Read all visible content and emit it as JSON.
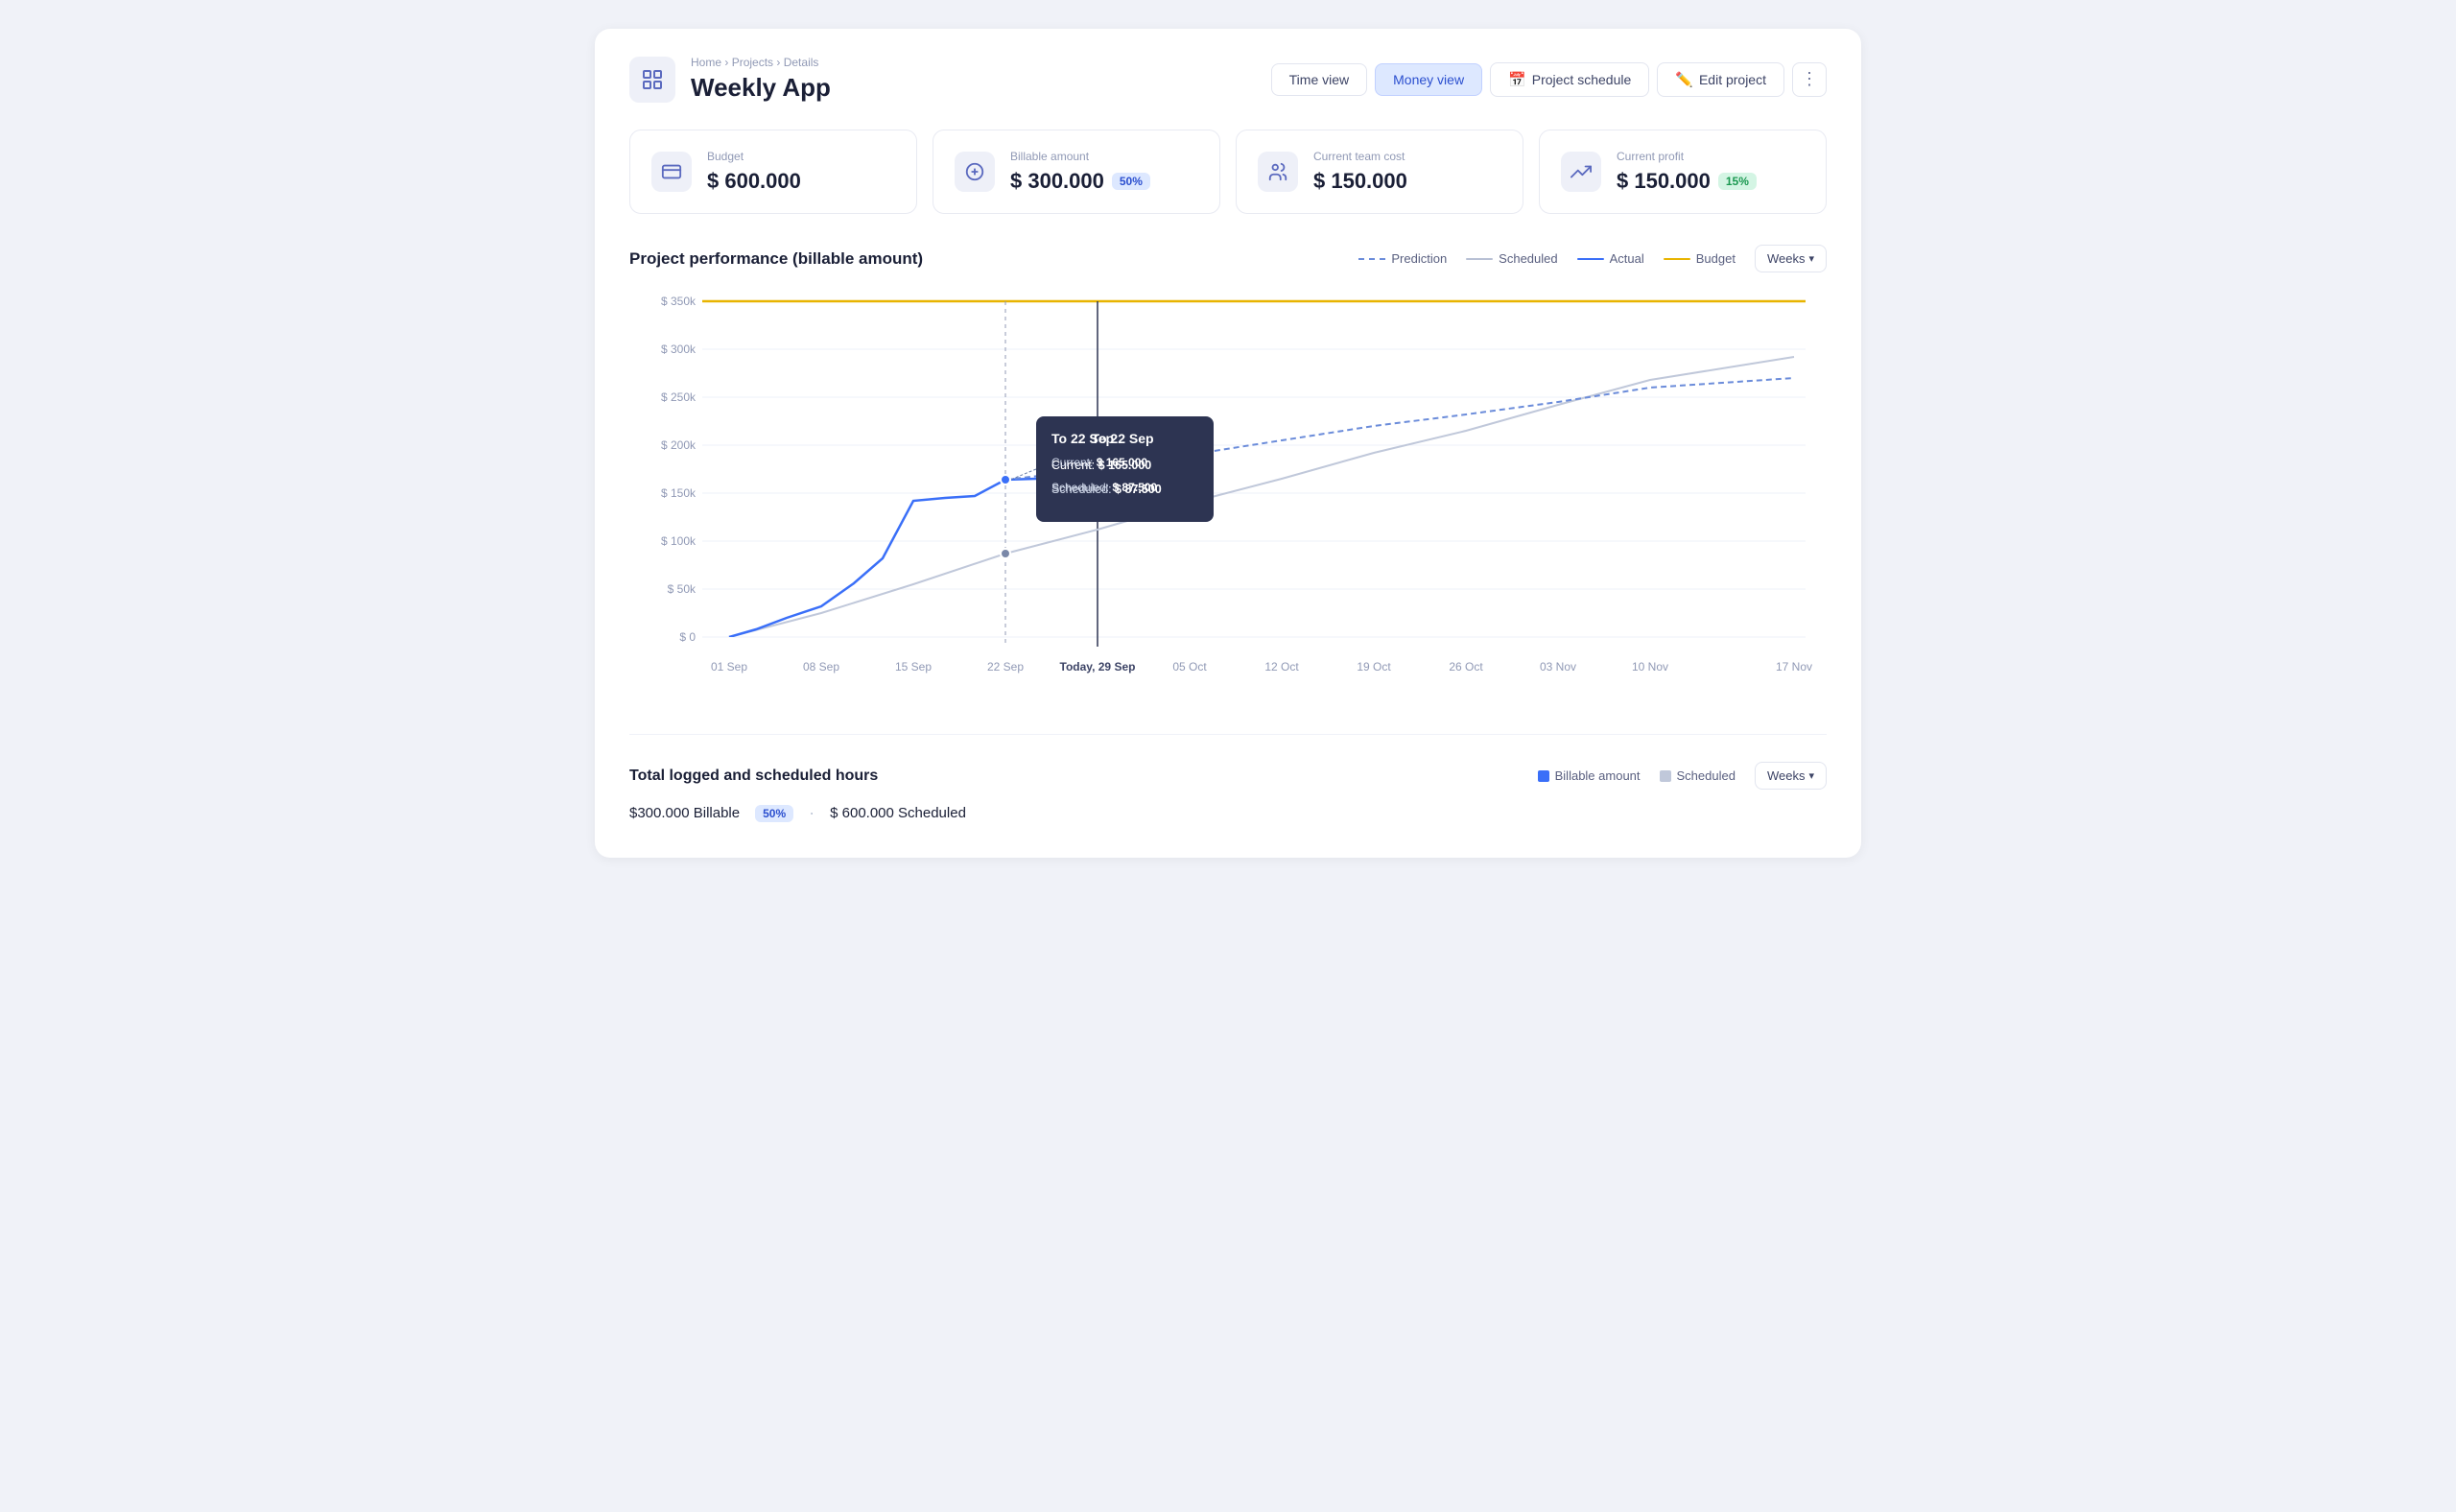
{
  "breadcrumb": {
    "home": "Home",
    "projects": "Projects",
    "details": "Details"
  },
  "page": {
    "title": "Weekly App"
  },
  "nav": {
    "time_view": "Time view",
    "money_view": "Money view",
    "project_schedule": "Project schedule",
    "edit_project": "Edit project",
    "more_icon": "⋮"
  },
  "kpi": [
    {
      "id": "budget",
      "label": "Budget",
      "value": "$ 600.000",
      "badge": null,
      "icon": "💳"
    },
    {
      "id": "billable",
      "label": "Billable amount",
      "value": "$ 300.000",
      "badge": "50%",
      "badge_type": "blue",
      "icon": "💱"
    },
    {
      "id": "team-cost",
      "label": "Current team cost",
      "value": "$ 150.000",
      "badge": null,
      "icon": "👥"
    },
    {
      "id": "profit",
      "label": "Current profit",
      "value": "$ 150.000",
      "badge": "15%",
      "badge_type": "green",
      "icon": "📈"
    }
  ],
  "chart": {
    "title": "Project performance (billable amount)",
    "legend": [
      {
        "id": "prediction",
        "label": "Prediction",
        "type": "dashed-blue"
      },
      {
        "id": "scheduled",
        "label": "Scheduled",
        "type": "gray"
      },
      {
        "id": "actual",
        "label": "Actual",
        "type": "blue"
      },
      {
        "id": "budget",
        "label": "Budget",
        "type": "yellow"
      }
    ],
    "weeks_label": "Weeks",
    "tooltip": {
      "date": "To 22 Sep",
      "current_label": "Current:",
      "current_value": "$ 165.000",
      "scheduled_label": "Scheduled:",
      "scheduled_value": "$ 87.500"
    },
    "y_labels": [
      "$ 350k",
      "$ 300k",
      "$ 250k",
      "$ 200k",
      "$ 150k",
      "$ 100k",
      "$ 50k",
      "$ 0"
    ],
    "x_labels": [
      "01 Sep",
      "08 Sep",
      "15 Sep",
      "22 Sep",
      "Today, 29 Sep",
      "05 Oct",
      "12 Oct",
      "19 Oct",
      "26 Oct",
      "03 Nov",
      "10 Nov",
      "17 Nov"
    ]
  },
  "bottom": {
    "title": "Total logged and scheduled hours",
    "legend": [
      {
        "id": "billable-amount",
        "label": "Billable amount",
        "color": "#3a6ff8"
      },
      {
        "id": "scheduled",
        "label": "Scheduled",
        "color": "#b0b8cc"
      }
    ],
    "weeks_label": "Weeks",
    "stat_billable": "$300.000 Billable",
    "stat_badge": "50%",
    "stat_scheduled": "$ 600.000 Scheduled"
  }
}
